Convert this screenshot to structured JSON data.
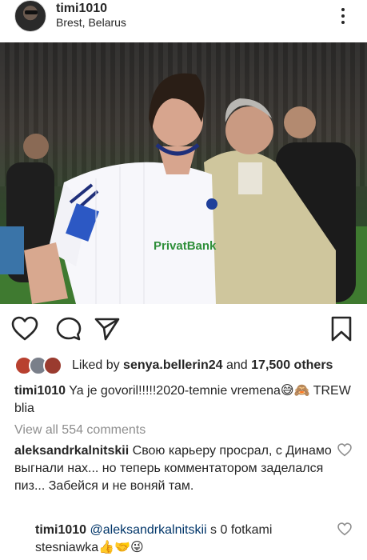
{
  "post": {
    "username": "timi1010",
    "location": "Brest, Belarus"
  },
  "photo": {
    "jersey_sponsor": "PrivatBank"
  },
  "likes": {
    "prefix": "Liked by ",
    "liker": "senya.bellerin24",
    "middle": " and ",
    "count": "17,500 others"
  },
  "caption": {
    "username": "timi1010",
    "text": "Ya je govoril!!!!!2020-temnie vremena😅🙈 TREW blia"
  },
  "view_all_comments": "View all 554 comments",
  "comments": [
    {
      "username": "aleksandrkalnitskii",
      "text": "Свою карьеру просрал, с Динамо выгнали нах... но теперь комментатором заделался пиз... Забейся и не воняй там."
    },
    {
      "username": "timi1010",
      "mention": "@aleksandrkalnitskii",
      "text": " s 0 fotkami stesniawka👍🤝😜"
    }
  ],
  "icons": {
    "more": "more-vertical-icon",
    "like": "heart-icon",
    "comment": "comment-icon",
    "share": "send-icon",
    "save": "bookmark-icon"
  }
}
